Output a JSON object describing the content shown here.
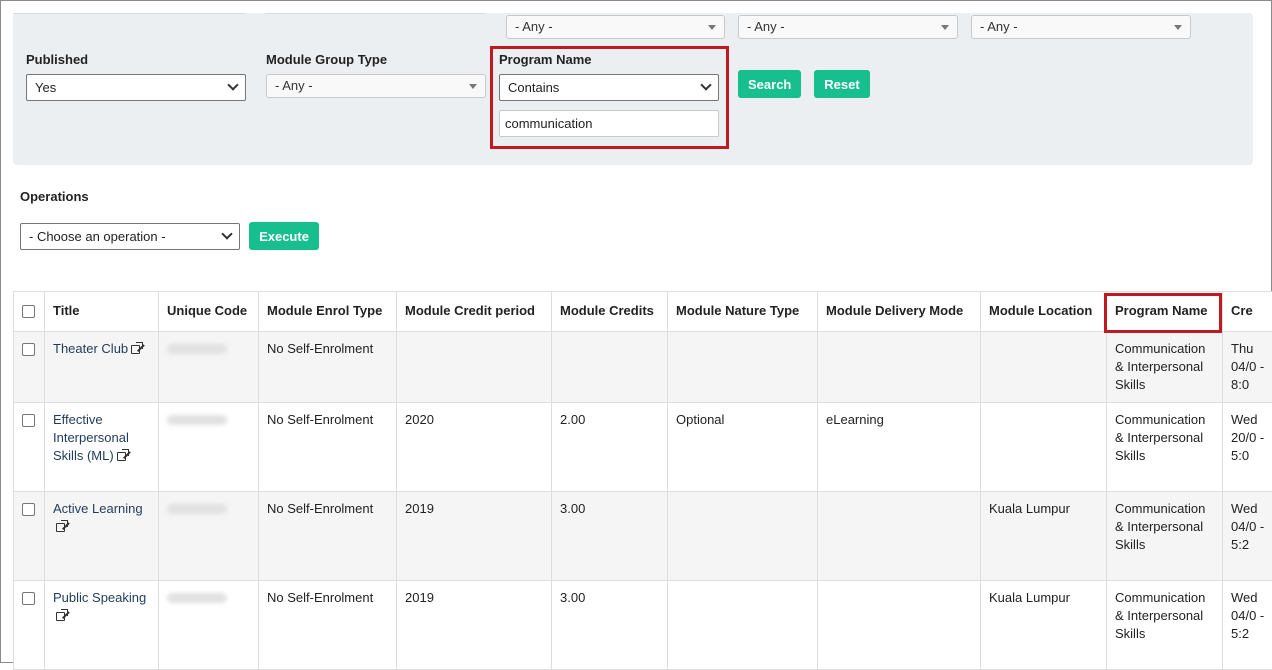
{
  "filters": {
    "top_any_1": "- Any -",
    "top_any_2": "- Any -",
    "top_any_3": "- Any -",
    "published": {
      "label": "Published",
      "value": "Yes"
    },
    "module_group_type": {
      "label": "Module Group Type",
      "value": "- Any -"
    },
    "program_name": {
      "label": "Program Name",
      "operator": "Contains",
      "value": "communication"
    },
    "search_label": "Search",
    "reset_label": "Reset"
  },
  "operations": {
    "label": "Operations",
    "select_value": "- Choose an operation -",
    "execute_label": "Execute"
  },
  "table": {
    "columns": [
      "Title",
      "Unique Code",
      "Module Enrol Type",
      "Module Credit period",
      "Module Credits",
      "Module Nature Type",
      "Module Delivery Mode",
      "Module Location",
      "Program Name",
      "Cre"
    ],
    "rows": [
      {
        "title": "Theater Club",
        "enrol": "No Self-Enrolment",
        "period": "",
        "credits": "",
        "nature": "",
        "delivery": "",
        "location": "",
        "program": "Communication & Interpersonal Skills",
        "created": "Thu 04/0 - 8:0"
      },
      {
        "title": "Effective Interpersonal Skills (ML)",
        "enrol": "No Self-Enrolment",
        "period": "2020",
        "credits": "2.00",
        "nature": "Optional",
        "delivery": "eLearning",
        "location": "",
        "program": "Communication & Interpersonal Skills",
        "created": "Wed 20/0 - 5:0"
      },
      {
        "title": "Active Learning",
        "enrol": "No Self-Enrolment",
        "period": "2019",
        "credits": "3.00",
        "nature": "",
        "delivery": "",
        "location": "Kuala Lumpur",
        "program": "Communication & Interpersonal Skills",
        "created": "Wed 04/0 - 5:2"
      },
      {
        "title": "Public Speaking",
        "enrol": "No Self-Enrolment",
        "period": "2019",
        "credits": "3.00",
        "nature": "",
        "delivery": "",
        "location": "Kuala Lumpur",
        "program": "Communication & Interpersonal Skills",
        "created": "Wed 04/0 - 5:2"
      }
    ]
  }
}
